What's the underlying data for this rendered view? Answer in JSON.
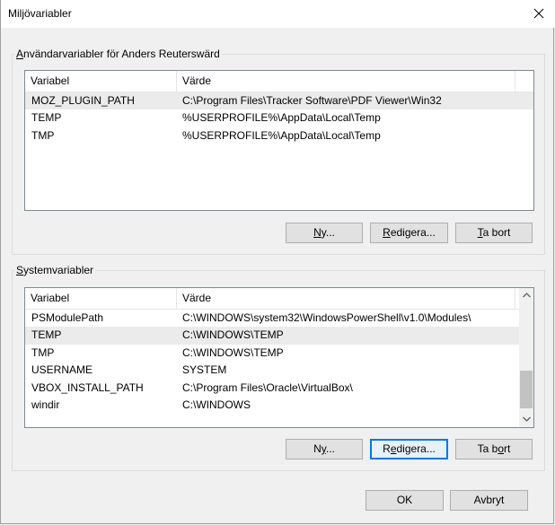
{
  "window": {
    "title": "Miljövariabler"
  },
  "icons": {
    "close": "close-icon",
    "scroll_up": "chevron-up-icon",
    "scroll_down": "chevron-down-icon"
  },
  "user_vars": {
    "group_label": {
      "prefix": "",
      "mnemonic": "A",
      "rest": "nvändarvariabler för Anders Reuterswärd"
    },
    "columns": [
      "Variabel",
      "Värde"
    ],
    "rows": [
      {
        "name": "MOZ_PLUGIN_PATH",
        "value": "C:\\Program Files\\Tracker Software\\PDF Viewer\\Win32",
        "selected": true
      },
      {
        "name": "TEMP",
        "value": "%USERPROFILE%\\AppData\\Local\\Temp",
        "selected": false
      },
      {
        "name": "TMP",
        "value": "%USERPROFILE%\\AppData\\Local\\Temp",
        "selected": false
      }
    ],
    "buttons": {
      "new": {
        "prefix": "",
        "mnemonic": "N",
        "rest": "y..."
      },
      "edit": {
        "prefix": "",
        "mnemonic": "R",
        "rest": "edigera..."
      },
      "delete": {
        "prefix": "",
        "mnemonic": "T",
        "rest": "a bort"
      }
    }
  },
  "system_vars": {
    "group_label": {
      "prefix": "",
      "mnemonic": "S",
      "rest": "ystemvariabler"
    },
    "columns": [
      "Variabel",
      "Värde"
    ],
    "rows": [
      {
        "name": "PSModulePath",
        "value": "C:\\WINDOWS\\system32\\WindowsPowerShell\\v1.0\\Modules\\",
        "selected": false
      },
      {
        "name": "TEMP",
        "value": "C:\\WINDOWS\\TEMP",
        "selected": true
      },
      {
        "name": "TMP",
        "value": "C:\\WINDOWS\\TEMP",
        "selected": false
      },
      {
        "name": "USERNAME",
        "value": "SYSTEM",
        "selected": false
      },
      {
        "name": "VBOX_INSTALL_PATH",
        "value": "C:\\Program Files\\Oracle\\VirtualBox\\",
        "selected": false
      },
      {
        "name": "windir",
        "value": "C:\\WINDOWS",
        "selected": false
      }
    ],
    "buttons": {
      "new": {
        "prefix": "N",
        "mnemonic": "y",
        "rest": "..."
      },
      "edit": {
        "prefix": "R",
        "mnemonic": "e",
        "rest": "digera..."
      },
      "delete": {
        "prefix": "Ta b",
        "mnemonic": "o",
        "rest": "rt"
      }
    }
  },
  "footer": {
    "ok": "OK",
    "cancel": "Avbryt"
  },
  "colors": {
    "focus_border": "#0078d7",
    "selection": "#ebebeb",
    "scroll_thumb": "#c2c2c2"
  }
}
